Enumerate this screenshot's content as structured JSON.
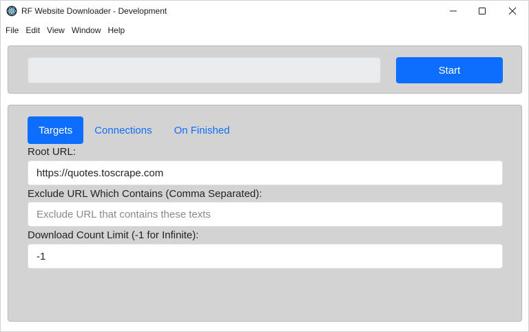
{
  "window": {
    "title": "RF Website Downloader - Development"
  },
  "menu": {
    "items": [
      "File",
      "Edit",
      "View",
      "Window",
      "Help"
    ]
  },
  "top_bar": {
    "url_value": "",
    "start_label": "Start"
  },
  "tabs": [
    {
      "label": "Targets",
      "active": true
    },
    {
      "label": "Connections",
      "active": false
    },
    {
      "label": "On Finished",
      "active": false
    }
  ],
  "form": {
    "root_url": {
      "label": "Root URL:",
      "value": "https://quotes.toscrape.com"
    },
    "exclude": {
      "label": "Exclude URL Which Contains (Comma Separated):",
      "placeholder": "Exclude URL that contains these texts",
      "value": ""
    },
    "download_limit": {
      "label": "Download Count Limit (-1 for Infinite):",
      "value": "-1"
    }
  },
  "colors": {
    "accent": "#0d6efd",
    "panel": "#d3d3d3"
  },
  "icons": {
    "app": "electron-atom-icon",
    "minimize": "minimize-icon",
    "maximize": "maximize-icon",
    "close": "close-icon"
  }
}
